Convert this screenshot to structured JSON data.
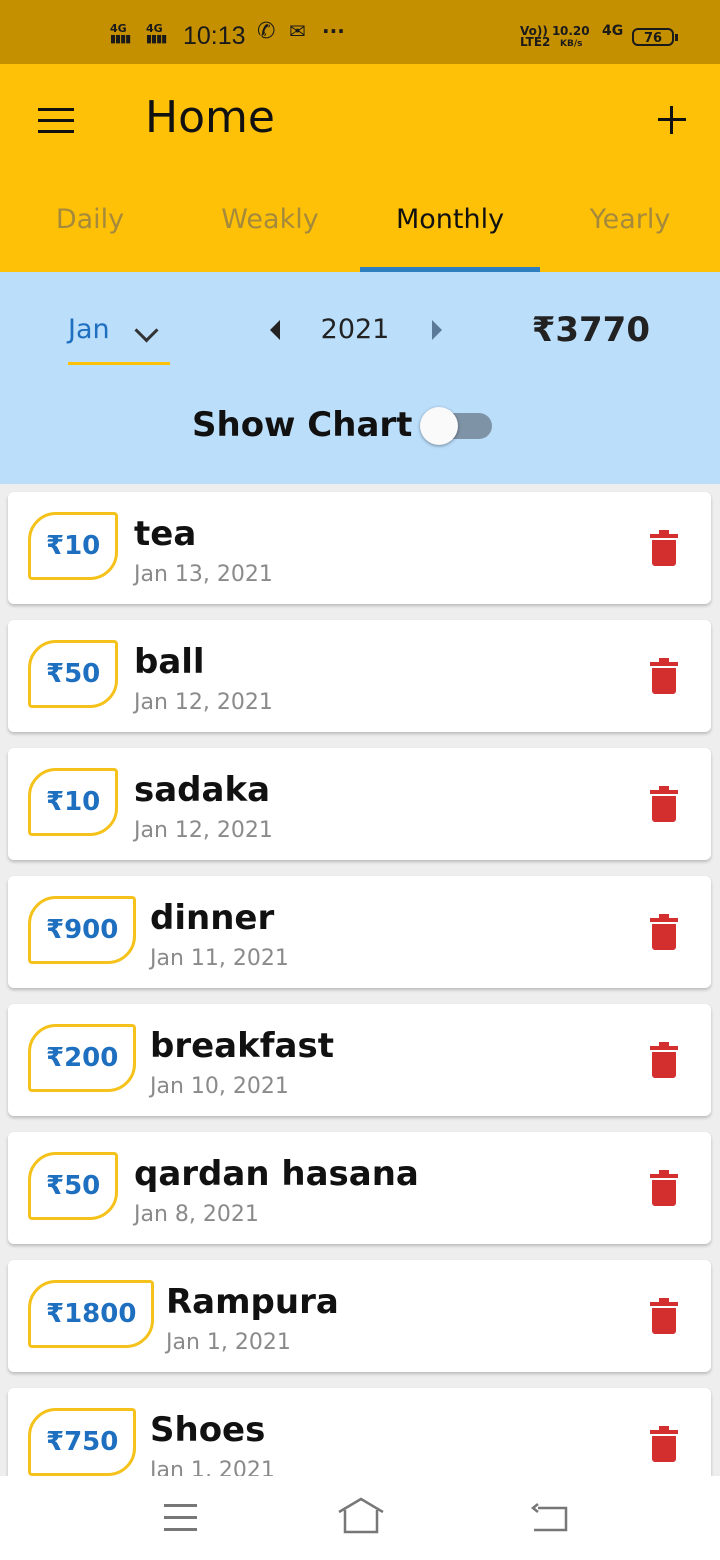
{
  "status_bar": {
    "time": "10:13",
    "signal1": "4G",
    "signal2": "4G",
    "volte": "Vo)) 1",
    "lte": "LTE2",
    "speed": "0.20",
    "speed_unit": "KB/s",
    "network": "4G",
    "battery": "76",
    "more": "···"
  },
  "header": {
    "title": "Home"
  },
  "tabs": [
    {
      "label": "Daily",
      "active": false
    },
    {
      "label": "Weakly",
      "active": false
    },
    {
      "label": "Monthly",
      "active": true
    },
    {
      "label": "Yearly",
      "active": false
    }
  ],
  "filter": {
    "month": "Jan",
    "year": "2021",
    "total": "₹3770",
    "show_chart_label": "Show Chart",
    "show_chart_on": false
  },
  "expenses": [
    {
      "amount": "₹10",
      "title": "tea",
      "date": "Jan 13, 2021"
    },
    {
      "amount": "₹50",
      "title": "ball",
      "date": "Jan 12, 2021"
    },
    {
      "amount": "₹10",
      "title": "sadaka",
      "date": "Jan 12, 2021"
    },
    {
      "amount": "₹900",
      "title": "dinner",
      "date": "Jan 11, 2021"
    },
    {
      "amount": "₹200",
      "title": "breakfast",
      "date": "Jan 10, 2021"
    },
    {
      "amount": "₹50",
      "title": "qardan hasana",
      "date": "Jan 8, 2021"
    },
    {
      "amount": "₹1800",
      "title": "Rampura",
      "date": "Jan 1, 2021"
    },
    {
      "amount": "₹750",
      "title": "Shoes",
      "date": "Jan 1, 2021"
    }
  ],
  "colors": {
    "status_bar": "#c49000",
    "app_bar": "#ffc107",
    "filter_panel": "#bbdefb",
    "accent_blue": "#1e6fbf",
    "delete_red": "#d32f2f"
  }
}
